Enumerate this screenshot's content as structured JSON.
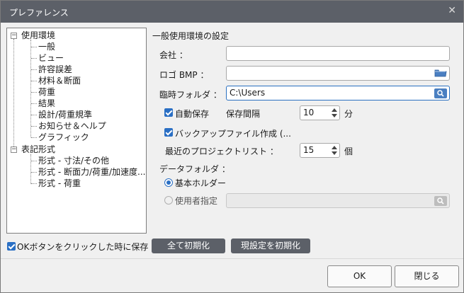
{
  "window": {
    "title": "プレファレンス",
    "close_glyph": "✕"
  },
  "tree": {
    "groups": [
      {
        "label": "使用環境",
        "expander": "−",
        "children": [
          "一般",
          "ビュー",
          "許容誤差",
          "材料＆断面",
          "荷重",
          "結果",
          "設計/荷重規準",
          "お知らせ＆ヘルプ",
          "グラフィック"
        ]
      },
      {
        "label": "表記形式",
        "expander": "−",
        "children": [
          "形式 - 寸法/その他",
          "形式 - 断面力/荷重/加速度...",
          "形式 - 荷重"
        ]
      }
    ]
  },
  "panel": {
    "section_title": "一般使用環境の設定",
    "company_label": "会社 ：",
    "company_value": "",
    "logo_label": "ロゴ BMP ：",
    "logo_value": "",
    "tempfolder_label": "臨時フォルダ ：",
    "tempfolder_value": "C:\\Users",
    "autosave_label": "自動保存",
    "save_interval_label": "保存間隔",
    "save_interval_value": "10",
    "save_interval_unit": "分",
    "backup_label": "バックアップファイル作成 (...",
    "recent_label": "最近のプロジェクトリスト ：",
    "recent_value": "15",
    "recent_unit": "個",
    "datafolder_label": "データフォルダ ：",
    "basic_holder_label": "基本ホルダー",
    "user_specified_label": "使用者指定",
    "user_specified_value": ""
  },
  "bottom": {
    "save_on_ok_label": "OKボタンをクリックした時に保存",
    "reset_all_label": "全て初期化",
    "reset_current_label": "現設定を初期化"
  },
  "footer": {
    "ok_label": "OK",
    "close_label": "閉じる"
  },
  "colors": {
    "accent": "#2a6fc4",
    "titlebar": "#5c6068"
  }
}
